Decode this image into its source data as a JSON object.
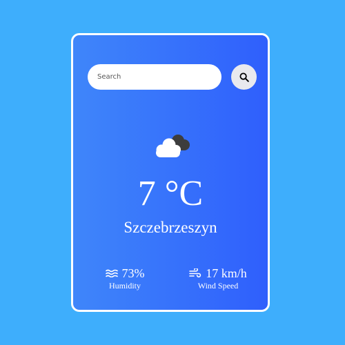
{
  "search": {
    "placeholder": "Search",
    "value": ""
  },
  "weather": {
    "icon": "cloud-icon",
    "temperature": "7 °C",
    "city": "Szczebrzeszyn"
  },
  "details": {
    "humidity": {
      "icon": "humidity-waves-icon",
      "value": "73%",
      "label": "Humidity"
    },
    "wind": {
      "icon": "wind-icon",
      "value": "17 km/h",
      "label": "Wind Speed"
    }
  },
  "colors": {
    "page_background": "#3eaefc",
    "card_gradient_start": "#3f86fa",
    "card_gradient_end": "#2f5ffc",
    "search_button": "#e9e9ee"
  }
}
